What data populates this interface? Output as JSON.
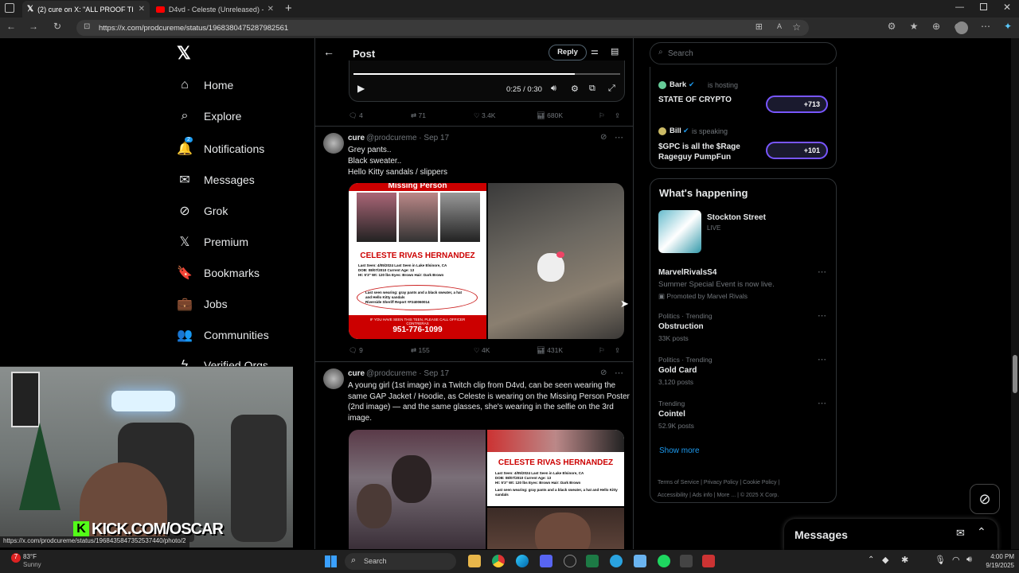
{
  "browser": {
    "tabs": [
      {
        "title": "(2) cure on X: \"ALL PROOF THAT ..."
      },
      {
        "title": "D4vd - Celeste (Unreleased) - Yo..."
      }
    ],
    "url": "https://x.com/prodcureme/status/1968380475287982561",
    "status_url": "https://x.com/prodcureme/status/1968435847352537440/photo/2"
  },
  "sidebar": {
    "items": [
      {
        "label": "Home",
        "icon": "home-icon"
      },
      {
        "label": "Explore",
        "icon": "search-icon"
      },
      {
        "label": "Notifications",
        "icon": "bell-icon",
        "badge": "2"
      },
      {
        "label": "Messages",
        "icon": "mail-icon"
      },
      {
        "label": "Grok",
        "icon": "grok-icon"
      },
      {
        "label": "Premium",
        "icon": "x-logo-icon"
      },
      {
        "label": "Bookmarks",
        "icon": "bookmark-icon"
      },
      {
        "label": "Jobs",
        "icon": "briefcase-icon"
      },
      {
        "label": "Communities",
        "icon": "people-icon"
      },
      {
        "label": "Verified Orgs",
        "icon": "lightning-icon"
      }
    ]
  },
  "header": {
    "title": "Post",
    "reply_label": "Reply"
  },
  "video": {
    "time": "0:25 / 0:30",
    "progress": 0.83
  },
  "post0_stats": {
    "replies": "4",
    "reposts": "71",
    "likes": "3.4K",
    "views": "680K"
  },
  "posts": [
    {
      "name": "cure",
      "handle": "@prodcureme · Sep 17",
      "text": [
        "Grey pants..",
        "Black sweater..",
        "Hello Kitty sandals / slippers"
      ],
      "poster": {
        "heading": "Missing Person",
        "name": "CELESTE RIVAS HERNANDEZ",
        "details": [
          "Last Seen: 4/05/2024   Last Seen in Lake Elsinore, CA",
          "DOB: 08/07/2010   Current Age: 13",
          "Ht: 5'3\"  Wt: 120 lbs   Eyes: Brown  Hair: Dark Brown"
        ],
        "wearing": "Last seen wearing: gray pants and a black sweater, a hat and Hello Kitty sandals",
        "case": "Riverside Sheriff Report #F240060014",
        "footer": "IF YOU HAVE SEEN THIS TEEN, PLEASE CALL OFFICER CONTRERAS",
        "phone": "951-776-1099"
      },
      "stats": {
        "replies": "9",
        "reposts": "155",
        "likes": "4K",
        "views": "431K"
      }
    },
    {
      "name": "cure",
      "handle": "@prodcureme · Sep 17",
      "text": [
        "A young girl (1st image) in a Twitch clip from D4vd, can be seen wearing the",
        "same GAP Jacket / Hoodie, as Celeste is wearing on the Missing Person Poster",
        "(2nd image) — and the same glasses, she's wearing in the selfie on the 3rd",
        "image."
      ],
      "poster": {
        "name": "CELESTE RIVAS HERNANDEZ",
        "details": [
          "Last Seen: 4/05/2024   Last Seen in Lake Elsinore, CA",
          "DOB: 08/07/2010   Current Age: 13",
          "Ht: 5'3\"  Wt: 120 lbs   Eyes: Brown  Hair: Dark Brown"
        ],
        "wearing": "Last seen wearing: gray pants and a black sweater, a hat and Hello Kitty sandals"
      }
    }
  ],
  "search": {
    "placeholder": "Search"
  },
  "spaces": [
    {
      "host": "Bark",
      "status": "is hosting",
      "title": "STATE OF CRYPTO",
      "count": "+713"
    },
    {
      "host": "Bill",
      "status": "is speaking",
      "title": "$GPC is  all the $Rage Rageguy PumpFun",
      "count": "+101"
    }
  ],
  "happening": {
    "title": "What's happening",
    "live": {
      "title": "Stockton Street",
      "badge": "LIVE"
    },
    "items": [
      {
        "context": "",
        "title": "MarvelRivalsS4",
        "sub": "Summer Special Event is now live.",
        "promo": "Promoted by Marvel Rivals"
      },
      {
        "context": "Politics · Trending",
        "title": "Obstruction",
        "sub": "33K posts"
      },
      {
        "context": "Politics · Trending",
        "title": "Gold Card",
        "sub": "3,120 posts"
      },
      {
        "context": "Trending",
        "title": "Cointel",
        "sub": "52.9K posts"
      }
    ],
    "show_more": "Show more"
  },
  "footer_links": [
    "Terms of Service",
    "Privacy Policy",
    "Cookie Policy",
    "Accessibility",
    "Ads info",
    "More ...",
    "© 2025 X Corp."
  ],
  "messages_label": "Messages",
  "webcam": {
    "overlay": "KICK.COM/OSCAR"
  },
  "taskbar": {
    "weather_temp": "83°F",
    "weather_desc": "Sunny",
    "search_label": "Search",
    "time": "4:00 PM",
    "date": "9/19/2025"
  },
  "colors": {
    "accent": "#1d9bf0",
    "verified": "#1d9bf0",
    "space_border": "#7856ff",
    "kick_green": "#53fc18"
  }
}
